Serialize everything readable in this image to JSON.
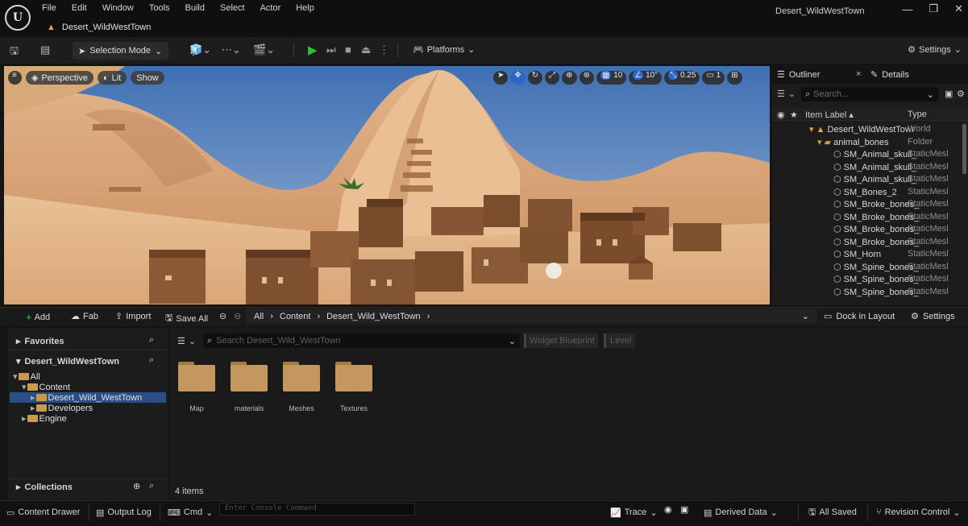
{
  "app": {
    "window_title": "Desert_WildWestTown",
    "document_tab": "Desert_WildWestTown",
    "logo": "unreal-engine-logo"
  },
  "menu": [
    "File",
    "Edit",
    "Window",
    "Tools",
    "Build",
    "Select",
    "Actor",
    "Help"
  ],
  "toolbar": {
    "selection_mode": "Selection Mode",
    "platforms": "Platforms",
    "settings": "Settings"
  },
  "viewport": {
    "perspective": "Perspective",
    "lit": "Lit",
    "show": "Show",
    "grid_snap": "10",
    "rotation_snap": "10°",
    "scale_snap": "0.25",
    "camera_speed": "1"
  },
  "outliner": {
    "tab_outliner": "Outliner",
    "tab_details": "Details",
    "search_placeholder": "Search...",
    "col_item_label": "Item Label",
    "col_type": "Type",
    "rows": [
      {
        "label": "Desert_WildWestTowr",
        "type": "World",
        "indent": 0
      },
      {
        "label": "animal_bones",
        "type": "Folder",
        "indent": 1
      },
      {
        "label": "SM_Animal_skull_",
        "type": "StaticMesl",
        "indent": 2
      },
      {
        "label": "SM_Animal_skull_",
        "type": "StaticMesl",
        "indent": 2
      },
      {
        "label": "SM_Animal_skull_",
        "type": "StaticMesl",
        "indent": 2
      },
      {
        "label": "SM_Bones_2",
        "type": "StaticMesl",
        "indent": 2
      },
      {
        "label": "SM_Broke_bones_",
        "type": "StaticMesl",
        "indent": 2
      },
      {
        "label": "SM_Broke_bones_",
        "type": "StaticMesl",
        "indent": 2
      },
      {
        "label": "SM_Broke_bones_",
        "type": "StaticMesl",
        "indent": 2
      },
      {
        "label": "SM_Broke_bones_",
        "type": "StaticMesl",
        "indent": 2
      },
      {
        "label": "SM_Horn",
        "type": "StaticMesl",
        "indent": 2
      },
      {
        "label": "SM_Spine_bones_",
        "type": "StaticMesl",
        "indent": 2
      },
      {
        "label": "SM_Spine_bones_",
        "type": "StaticMesl",
        "indent": 2
      },
      {
        "label": "SM_Spine_bones_",
        "type": "StaticMesl",
        "indent": 2
      }
    ]
  },
  "content_browser": {
    "add": "Add",
    "fab": "Fab",
    "import": "Import",
    "save_all": "Save All",
    "breadcrumb": [
      "All",
      "Content",
      "Desert_Wild_WestTown"
    ],
    "dock_in_layout": "Dock in Layout",
    "settings": "Settings",
    "favorites": "Favorites",
    "project": "Desert_WildWestTown",
    "tree": [
      {
        "label": "All",
        "indent": 0,
        "selected": false
      },
      {
        "label": "Content",
        "indent": 1,
        "selected": false
      },
      {
        "label": "Desert_Wild_WestTown",
        "indent": 2,
        "selected": true
      },
      {
        "label": "Developers",
        "indent": 2,
        "selected": false
      },
      {
        "label": "Engine",
        "indent": 1,
        "selected": false
      }
    ],
    "collections": "Collections",
    "search_placeholder": "Search Desert_Wild_WestTown",
    "filter_widget_blueprint": "Widget Blueprint",
    "filter_level": "Level",
    "folders": [
      "Map",
      "materials",
      "Meshes",
      "Textures"
    ],
    "item_count": "4 items"
  },
  "statusbar": {
    "content_drawer": "Content Drawer",
    "output_log": "Output Log",
    "cmd": "Cmd",
    "console_placeholder": "Enter Console Command",
    "trace": "Trace",
    "derived_data": "Derived Data",
    "all_saved": "All Saved",
    "revision_control": "Revision Control"
  },
  "colors": {
    "accent_blue": "#2a67c9",
    "play_green": "#27c927",
    "folder": "#c4975e",
    "ue_orange": "#e8a33a"
  }
}
